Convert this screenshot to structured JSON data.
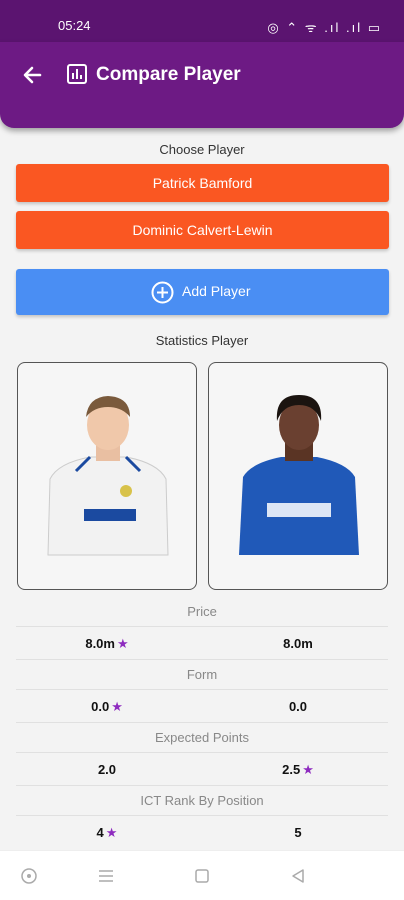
{
  "status_bar": {
    "time": "05:24",
    "right_icons": "◎ ⌃ ᯤ .ıl .ıl ▭"
  },
  "app_bar": {
    "title": "Compare Player",
    "back_icon": "arrow-left-icon",
    "title_icon": "bar-chart-icon"
  },
  "choose_label": "Choose Player",
  "players": [
    {
      "name": "Patrick Bamford"
    },
    {
      "name": "Dominic Calvert-Lewin"
    }
  ],
  "add_player": {
    "label": "Add Player",
    "icon": "plus-circle-icon"
  },
  "statistics_label": "Statistics Player",
  "stats": [
    {
      "label": "Price",
      "left": "8.0m",
      "right": "8.0m",
      "winner": "left"
    },
    {
      "label": "Form",
      "left": "0.0",
      "right": "0.0",
      "winner": "left"
    },
    {
      "label": "Expected Points",
      "left": "2.0",
      "right": "2.5",
      "winner": "right"
    },
    {
      "label": "ICT Rank By Position",
      "left": "4",
      "right": "5",
      "winner": "left"
    }
  ],
  "star_glyph": "★",
  "colors": {
    "app_bar": "#6d1a84",
    "player_button": "#fa5722",
    "add_button": "#4a8ef3",
    "star": "#8e2bbf"
  }
}
